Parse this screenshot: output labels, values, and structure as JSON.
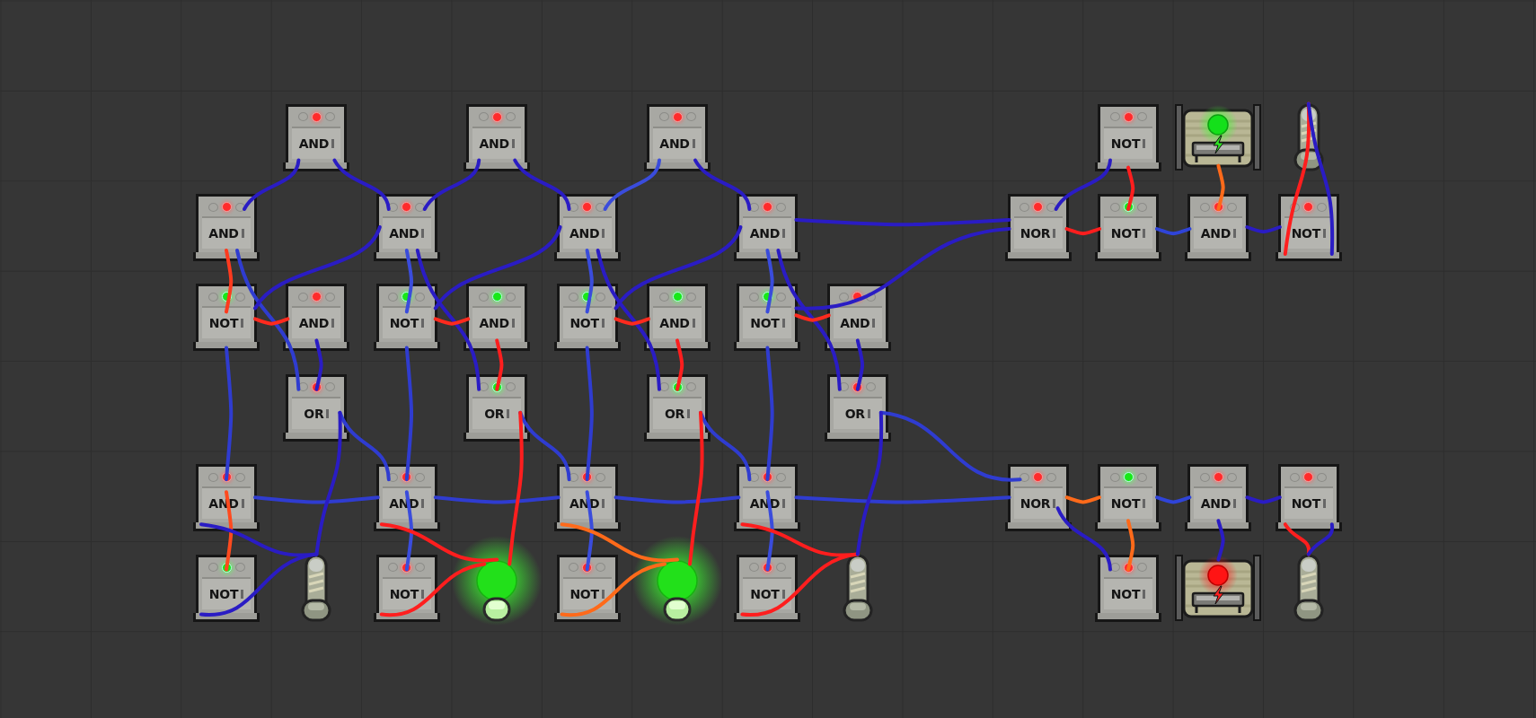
{
  "devices": [
    {
      "kind": "gate",
      "label": "AND",
      "on": false
    },
    {
      "kind": "gate",
      "label": "AND",
      "on": false
    },
    {
      "kind": "gate",
      "label": "AND",
      "on": false
    },
    {
      "kind": "gate",
      "label": "NOT",
      "on": false
    },
    {
      "kind": "shutoff",
      "on": true
    },
    {
      "kind": "switch"
    },
    {
      "kind": "gate",
      "label": "AND",
      "on": false
    },
    {
      "kind": "gate",
      "label": "AND",
      "on": false
    },
    {
      "kind": "gate",
      "label": "AND",
      "on": false
    },
    {
      "kind": "gate",
      "label": "AND",
      "on": false
    },
    {
      "kind": "gate",
      "label": "NOR",
      "on": false
    },
    {
      "kind": "gate",
      "label": "NOT",
      "on": true
    },
    {
      "kind": "gate",
      "label": "AND",
      "on": false
    },
    {
      "kind": "gate",
      "label": "NOT",
      "on": false
    },
    {
      "kind": "gate",
      "label": "NOT",
      "on": true
    },
    {
      "kind": "gate",
      "label": "AND",
      "on": false
    },
    {
      "kind": "gate",
      "label": "NOT",
      "on": true
    },
    {
      "kind": "gate",
      "label": "AND",
      "on": true
    },
    {
      "kind": "gate",
      "label": "NOT",
      "on": true
    },
    {
      "kind": "gate",
      "label": "AND",
      "on": true
    },
    {
      "kind": "gate",
      "label": "NOT",
      "on": true
    },
    {
      "kind": "gate",
      "label": "AND",
      "on": false
    },
    {
      "kind": "gate",
      "label": "OR",
      "on": false
    },
    {
      "kind": "gate",
      "label": "OR",
      "on": true
    },
    {
      "kind": "gate",
      "label": "OR",
      "on": true
    },
    {
      "kind": "gate",
      "label": "OR",
      "on": false
    },
    {
      "kind": "gate",
      "label": "AND",
      "on": false
    },
    {
      "kind": "gate",
      "label": "AND",
      "on": false
    },
    {
      "kind": "gate",
      "label": "AND",
      "on": false
    },
    {
      "kind": "gate",
      "label": "AND",
      "on": false
    },
    {
      "kind": "gate",
      "label": "NOR",
      "on": false
    },
    {
      "kind": "gate",
      "label": "NOT",
      "on": true
    },
    {
      "kind": "gate",
      "label": "AND",
      "on": false
    },
    {
      "kind": "gate",
      "label": "NOT",
      "on": false
    },
    {
      "kind": "gate",
      "label": "NOT",
      "on": true
    },
    {
      "kind": "switch"
    },
    {
      "kind": "gate",
      "label": "NOT",
      "on": false
    },
    {
      "kind": "lamp",
      "on": true
    },
    {
      "kind": "gate",
      "label": "NOT",
      "on": false
    },
    {
      "kind": "lamp",
      "on": true
    },
    {
      "kind": "gate",
      "label": "NOT",
      "on": false
    },
    {
      "kind": "switch"
    },
    {
      "kind": "gate",
      "label": "NOT",
      "on": false
    },
    {
      "kind": "shutoff",
      "on": false
    },
    {
      "kind": "switch"
    }
  ],
  "wires": [
    {
      "color": "#2a1cc4"
    },
    {
      "color": "#2a1cc4"
    },
    {
      "color": "#2a1cc4"
    },
    {
      "color": "#2a1cc4"
    },
    {
      "color": "#3a4cdc"
    },
    {
      "color": "#2a1cc4"
    },
    {
      "color": "#2a1cc4"
    },
    {
      "color": "#2a1cc4"
    },
    {
      "color": "#ff1e1e"
    },
    {
      "color": "#ff1e1e"
    },
    {
      "color": "#2f44d8"
    },
    {
      "color": "#ff6a1a"
    },
    {
      "color": "#2a1cc4"
    },
    {
      "color": "#ff1e1e"
    },
    {
      "color": "#2a1cc4"
    },
    {
      "color": "#ff3a1e"
    },
    {
      "color": "#2f3cd0"
    },
    {
      "color": "#2a1cc4"
    },
    {
      "color": "#ff2a1e"
    },
    {
      "color": "#2a1cc4"
    },
    {
      "color": "#3a4cdc"
    },
    {
      "color": "#2a1cc4"
    },
    {
      "color": "#2a1cc4"
    },
    {
      "color": "#ff2a1e"
    },
    {
      "color": "#ff1e1e"
    },
    {
      "color": "#3a4cdc"
    },
    {
      "color": "#2a1cc4"
    },
    {
      "color": "#2a1cc4"
    },
    {
      "color": "#ff2a1e"
    },
    {
      "color": "#ff1e1e"
    },
    {
      "color": "#3a4cdc"
    },
    {
      "color": "#2a1cc4"
    },
    {
      "color": "#2a1cc4"
    },
    {
      "color": "#ff2a1e"
    },
    {
      "color": "#2a1cc4"
    },
    {
      "color": "#2f3cd0"
    },
    {
      "color": "#2f3cd0"
    },
    {
      "color": "#2f3cd0"
    },
    {
      "color": "#2f3cd0"
    },
    {
      "color": "#2f3cd0"
    },
    {
      "color": "#2f3cd0"
    },
    {
      "color": "#2f3cd0"
    },
    {
      "color": "#2f3cd0"
    },
    {
      "color": "#2f3cd0"
    },
    {
      "color": "#2f3cd0"
    },
    {
      "color": "#2f3cd0"
    },
    {
      "color": "#2f3cd0"
    },
    {
      "color": "#ff4a1e"
    },
    {
      "color": "#2a1cc4"
    },
    {
      "color": "#2a1cc4"
    },
    {
      "color": "#2a1cc4"
    },
    {
      "color": "#3a4cdc"
    },
    {
      "color": "#ff1e1e"
    },
    {
      "color": "#ff1e1e"
    },
    {
      "color": "#ff1e1e"
    },
    {
      "color": "#3a4cdc"
    },
    {
      "color": "#ff6a1a"
    },
    {
      "color": "#ff6a1a"
    },
    {
      "color": "#ff1e1e"
    },
    {
      "color": "#3a4cdc"
    },
    {
      "color": "#ff1e1e"
    },
    {
      "color": "#ff1e1e"
    },
    {
      "color": "#2a1cc4"
    },
    {
      "color": "#ff6a1a"
    },
    {
      "color": "#2a1cc4"
    },
    {
      "color": "#ff6a1a"
    },
    {
      "color": "#2f44d8"
    },
    {
      "color": "#2a1cc4"
    },
    {
      "color": "#2a1cc4"
    },
    {
      "color": "#ff1e1e"
    },
    {
      "color": "#2a1cc4"
    }
  ]
}
